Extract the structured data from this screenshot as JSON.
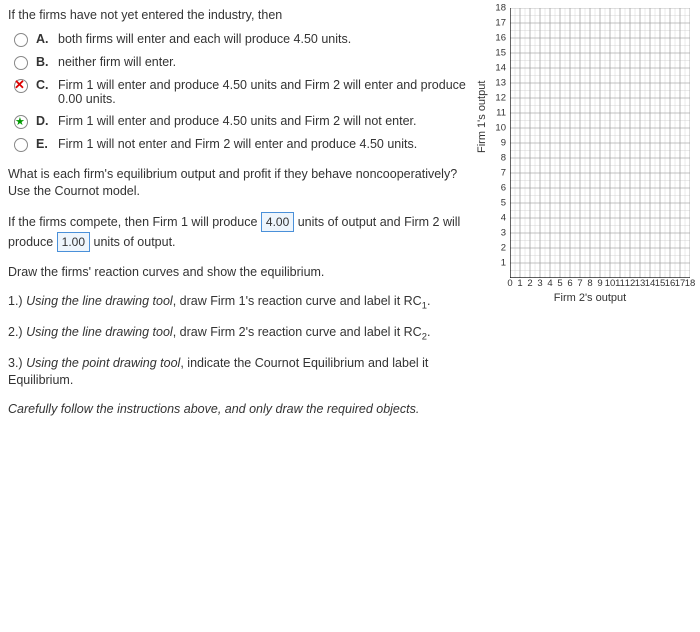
{
  "prompt": "If the firms have not yet entered the industry, then",
  "choices": [
    {
      "letter": "A.",
      "text": "both firms will enter and each will produce 4.50 units.",
      "state": "none"
    },
    {
      "letter": "B.",
      "text": "neither firm will enter.",
      "state": "none"
    },
    {
      "letter": "C.",
      "text": "Firm 1 will enter and produce 4.50 units and Firm 2 will enter and produce 0.00 units.",
      "state": "selected-wrong"
    },
    {
      "letter": "D.",
      "text": "Firm 1 will enter and produce 4.50 units and Firm 2 will not enter.",
      "state": "correct"
    },
    {
      "letter": "E.",
      "text": "Firm 1 will not enter and Firm 2 will enter and produce 4.50 units.",
      "state": "none"
    }
  ],
  "q2": {
    "lead": "What is each firm's equilibrium output and profit if they behave noncooperatively?  Use the Cournot model.",
    "sent_a": "If the firms compete, then Firm 1 will produce",
    "ans1": "4.00",
    "sent_b": "units of output and Firm 2 will produce",
    "ans2": "1.00",
    "sent_c": "units of output."
  },
  "draw_prompt": "Draw the firms' reaction curves and show the equilibrium.",
  "steps": [
    {
      "num": "1.)",
      "lead_italic": "Using the line drawing tool",
      "rest": ", draw Firm 1's reaction curve and label it RC",
      "sub": "1",
      "tail": "."
    },
    {
      "num": "2.)",
      "lead_italic": "Using the line drawing tool",
      "rest": ", draw Firm 2's reaction curve and label it RC",
      "sub": "2",
      "tail": "."
    },
    {
      "num": "3.)",
      "lead_italic": "Using the point drawing tool",
      "rest": ", indicate the Cournot Equilibrium and label it Equilibrium.",
      "sub": "",
      "tail": ""
    }
  ],
  "caution": "Carefully follow the instructions above, and only draw the required objects.",
  "chart_data": {
    "type": "scatter",
    "title": "",
    "xlabel": "Firm 2's output",
    "ylabel": "Firm 1's output",
    "xlim": [
      0,
      18
    ],
    "ylim": [
      0,
      18
    ],
    "xticks": [
      0,
      1,
      2,
      3,
      4,
      5,
      6,
      7,
      8,
      9,
      10,
      11,
      12,
      13,
      14,
      15,
      16,
      17,
      18
    ],
    "yticks": [
      0,
      1,
      2,
      3,
      4,
      5,
      6,
      7,
      8,
      9,
      10,
      11,
      12,
      13,
      14,
      15,
      16,
      17,
      18
    ],
    "series": []
  }
}
